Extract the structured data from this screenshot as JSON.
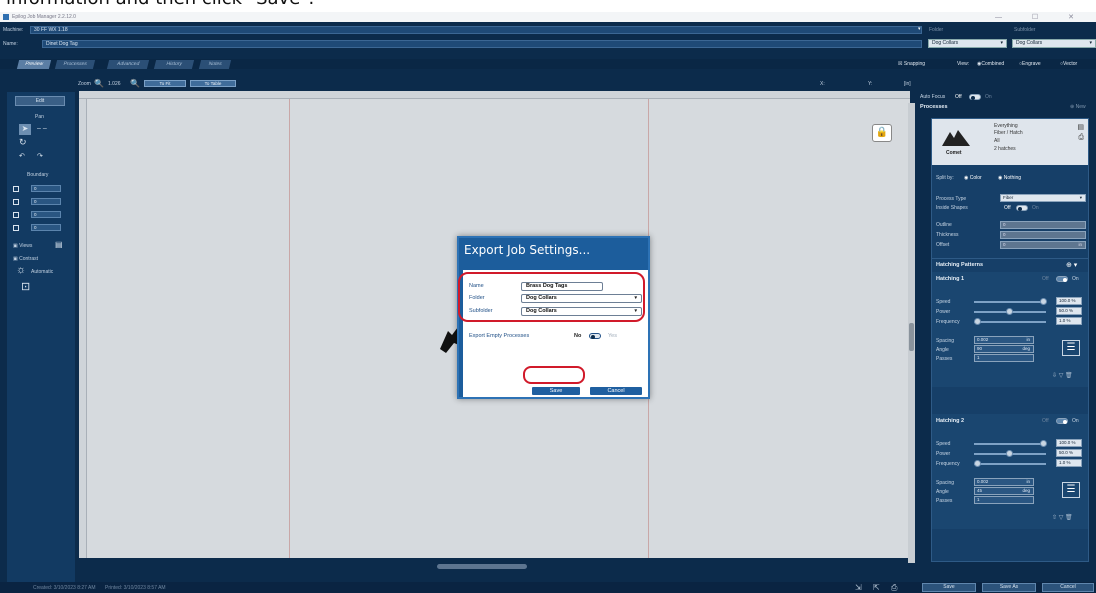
{
  "caption": "information and then click \"Save\".",
  "window": {
    "title": "Epilog Job Manager 2.2.12.0",
    "controls": "— ☐ ✕"
  },
  "header": {
    "machine_label": "Machine:",
    "machine_value": "30 FF WX 1.18",
    "name_label": "Name:",
    "name_value": "Dinet Dog Tag",
    "folder_label": "Folder",
    "folder_value": "Dog Collars",
    "subfolder_label": "Subfolder",
    "subfolder_value": "Dog Collars"
  },
  "tabs": [
    "Preview",
    "Processes",
    "Advanced",
    "History",
    "Notes"
  ],
  "view_options": {
    "snapping": "Snapping",
    "view_label": "View:",
    "combined": "Combined",
    "engrave": "Engrave",
    "vector": "Vector"
  },
  "zoom": {
    "label": "Zoom",
    "value": "1.026",
    "fit": "To Fit",
    "table": "To Table",
    "x_label": "X:",
    "y_label": "Y:",
    "in_label": "[in]"
  },
  "left_panel": {
    "edit_button": "Edit",
    "pan_label": "Pan",
    "boundary_label": "Boundary",
    "values": [
      "0",
      "0",
      "0",
      "0"
    ],
    "views_label": "Views",
    "contrast_label": "Contrast",
    "automatic_label": "Automatic"
  },
  "right_panel": {
    "auto_focus": "Auto Focus",
    "auto_focus_off": "Off",
    "auto_focus_on": "On",
    "processes_title": "Processes",
    "new_label": "New",
    "material_name": "Everything",
    "material_sub": "Fiber / Hatch",
    "material_note": "All",
    "material_count": "2 hatches",
    "logo_text": "Comet",
    "split_by": "Split by:",
    "split_color": "Color",
    "split_nothing": "Nothing",
    "process_type_label": "Process Type",
    "process_type_value": "Fiber",
    "inside_shapes_label": "Inside Shapes",
    "inside_off": "Off",
    "inside_on": "On",
    "outline_label": "Outline",
    "thickness_label": "Thickness",
    "offset_label": "Offset",
    "outline_value": "0",
    "thickness_value": "0",
    "offset_value": "0",
    "unit_in": "in",
    "hatching_patterns": "Hatching Patterns",
    "hatchings": [
      {
        "title": "Hatching 1",
        "speed_label": "Speed",
        "power_label": "Power",
        "frequency_label": "Frequency",
        "speed": "100.0 %",
        "power": "50.0 %",
        "frequency": "1.0 %",
        "spacing_label": "Spacing",
        "angle_label": "Angle",
        "passes_label": "Passes",
        "spacing": "0.002",
        "angle": "90",
        "passes": "1",
        "unit_in": "in",
        "unit_deg": "deg",
        "off": "Off",
        "on": "On"
      },
      {
        "title": "Hatching 2",
        "speed_label": "Speed",
        "power_label": "Power",
        "frequency_label": "Frequency",
        "speed": "100.0 %",
        "power": "50.0 %",
        "frequency": "1.0 %",
        "spacing_label": "Spacing",
        "angle_label": "Angle",
        "passes_label": "Passes",
        "spacing": "0.002",
        "angle": "45",
        "passes": "1",
        "unit_in": "in",
        "unit_deg": "deg",
        "off": "Off",
        "on": "On"
      }
    ]
  },
  "status": {
    "created": "Created: 3/10/2023 8:27 AM",
    "printed": "Printed: 3/10/2023 8:57 AM",
    "save": "Save",
    "save_as": "Save As",
    "cancel": "Cancel"
  },
  "dialog": {
    "title": "Export Job Settings...",
    "name_label": "Name",
    "name_value": "Brass Dog Tags",
    "folder_label": "Folder",
    "folder_value": "Dog Collars",
    "subfolder_label": "Subfolder",
    "subfolder_value": "Dog Collars",
    "export_empty_label": "Export Empty Processes",
    "no_label": "No",
    "yes_label": "Yes",
    "save_label": "Save",
    "cancel_label": "Cancel"
  },
  "colors": {
    "app_bg": "#0c2b4b",
    "dialog_bg": "#1c5d9c",
    "highlight": "#d11a2a"
  }
}
